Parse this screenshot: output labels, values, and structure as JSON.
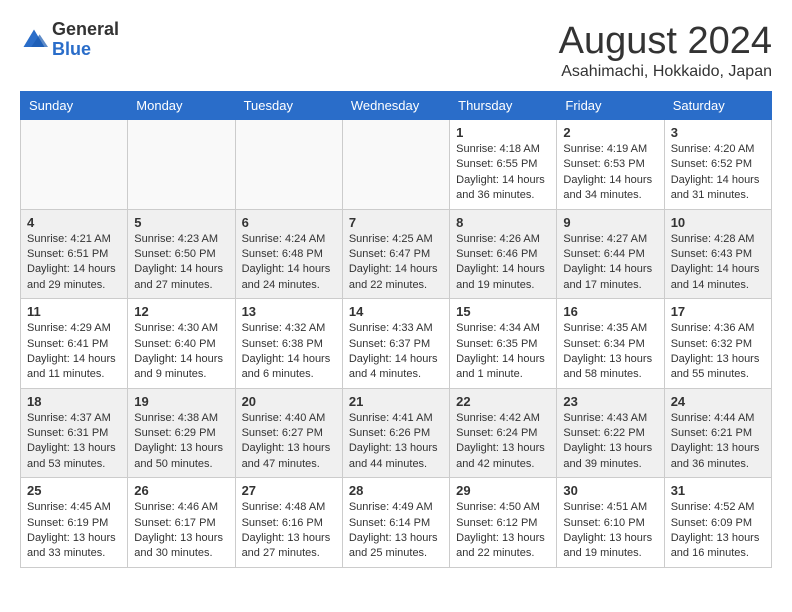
{
  "header": {
    "logo_general": "General",
    "logo_blue": "Blue",
    "month_title": "August 2024",
    "location": "Asahimachi, Hokkaido, Japan"
  },
  "weekdays": [
    "Sunday",
    "Monday",
    "Tuesday",
    "Wednesday",
    "Thursday",
    "Friday",
    "Saturday"
  ],
  "weeks": [
    [
      {
        "day": "",
        "info": "",
        "empty": true
      },
      {
        "day": "",
        "info": "",
        "empty": true
      },
      {
        "day": "",
        "info": "",
        "empty": true
      },
      {
        "day": "",
        "info": "",
        "empty": true
      },
      {
        "day": "1",
        "info": "Sunrise: 4:18 AM\nSunset: 6:55 PM\nDaylight: 14 hours\nand 36 minutes.",
        "empty": false
      },
      {
        "day": "2",
        "info": "Sunrise: 4:19 AM\nSunset: 6:53 PM\nDaylight: 14 hours\nand 34 minutes.",
        "empty": false
      },
      {
        "day": "3",
        "info": "Sunrise: 4:20 AM\nSunset: 6:52 PM\nDaylight: 14 hours\nand 31 minutes.",
        "empty": false
      }
    ],
    [
      {
        "day": "4",
        "info": "Sunrise: 4:21 AM\nSunset: 6:51 PM\nDaylight: 14 hours\nand 29 minutes.",
        "empty": false
      },
      {
        "day": "5",
        "info": "Sunrise: 4:23 AM\nSunset: 6:50 PM\nDaylight: 14 hours\nand 27 minutes.",
        "empty": false
      },
      {
        "day": "6",
        "info": "Sunrise: 4:24 AM\nSunset: 6:48 PM\nDaylight: 14 hours\nand 24 minutes.",
        "empty": false
      },
      {
        "day": "7",
        "info": "Sunrise: 4:25 AM\nSunset: 6:47 PM\nDaylight: 14 hours\nand 22 minutes.",
        "empty": false
      },
      {
        "day": "8",
        "info": "Sunrise: 4:26 AM\nSunset: 6:46 PM\nDaylight: 14 hours\nand 19 minutes.",
        "empty": false
      },
      {
        "day": "9",
        "info": "Sunrise: 4:27 AM\nSunset: 6:44 PM\nDaylight: 14 hours\nand 17 minutes.",
        "empty": false
      },
      {
        "day": "10",
        "info": "Sunrise: 4:28 AM\nSunset: 6:43 PM\nDaylight: 14 hours\nand 14 minutes.",
        "empty": false
      }
    ],
    [
      {
        "day": "11",
        "info": "Sunrise: 4:29 AM\nSunset: 6:41 PM\nDaylight: 14 hours\nand 11 minutes.",
        "empty": false
      },
      {
        "day": "12",
        "info": "Sunrise: 4:30 AM\nSunset: 6:40 PM\nDaylight: 14 hours\nand 9 minutes.",
        "empty": false
      },
      {
        "day": "13",
        "info": "Sunrise: 4:32 AM\nSunset: 6:38 PM\nDaylight: 14 hours\nand 6 minutes.",
        "empty": false
      },
      {
        "day": "14",
        "info": "Sunrise: 4:33 AM\nSunset: 6:37 PM\nDaylight: 14 hours\nand 4 minutes.",
        "empty": false
      },
      {
        "day": "15",
        "info": "Sunrise: 4:34 AM\nSunset: 6:35 PM\nDaylight: 14 hours\nand 1 minute.",
        "empty": false
      },
      {
        "day": "16",
        "info": "Sunrise: 4:35 AM\nSunset: 6:34 PM\nDaylight: 13 hours\nand 58 minutes.",
        "empty": false
      },
      {
        "day": "17",
        "info": "Sunrise: 4:36 AM\nSunset: 6:32 PM\nDaylight: 13 hours\nand 55 minutes.",
        "empty": false
      }
    ],
    [
      {
        "day": "18",
        "info": "Sunrise: 4:37 AM\nSunset: 6:31 PM\nDaylight: 13 hours\nand 53 minutes.",
        "empty": false
      },
      {
        "day": "19",
        "info": "Sunrise: 4:38 AM\nSunset: 6:29 PM\nDaylight: 13 hours\nand 50 minutes.",
        "empty": false
      },
      {
        "day": "20",
        "info": "Sunrise: 4:40 AM\nSunset: 6:27 PM\nDaylight: 13 hours\nand 47 minutes.",
        "empty": false
      },
      {
        "day": "21",
        "info": "Sunrise: 4:41 AM\nSunset: 6:26 PM\nDaylight: 13 hours\nand 44 minutes.",
        "empty": false
      },
      {
        "day": "22",
        "info": "Sunrise: 4:42 AM\nSunset: 6:24 PM\nDaylight: 13 hours\nand 42 minutes.",
        "empty": false
      },
      {
        "day": "23",
        "info": "Sunrise: 4:43 AM\nSunset: 6:22 PM\nDaylight: 13 hours\nand 39 minutes.",
        "empty": false
      },
      {
        "day": "24",
        "info": "Sunrise: 4:44 AM\nSunset: 6:21 PM\nDaylight: 13 hours\nand 36 minutes.",
        "empty": false
      }
    ],
    [
      {
        "day": "25",
        "info": "Sunrise: 4:45 AM\nSunset: 6:19 PM\nDaylight: 13 hours\nand 33 minutes.",
        "empty": false
      },
      {
        "day": "26",
        "info": "Sunrise: 4:46 AM\nSunset: 6:17 PM\nDaylight: 13 hours\nand 30 minutes.",
        "empty": false
      },
      {
        "day": "27",
        "info": "Sunrise: 4:48 AM\nSunset: 6:16 PM\nDaylight: 13 hours\nand 27 minutes.",
        "empty": false
      },
      {
        "day": "28",
        "info": "Sunrise: 4:49 AM\nSunset: 6:14 PM\nDaylight: 13 hours\nand 25 minutes.",
        "empty": false
      },
      {
        "day": "29",
        "info": "Sunrise: 4:50 AM\nSunset: 6:12 PM\nDaylight: 13 hours\nand 22 minutes.",
        "empty": false
      },
      {
        "day": "30",
        "info": "Sunrise: 4:51 AM\nSunset: 6:10 PM\nDaylight: 13 hours\nand 19 minutes.",
        "empty": false
      },
      {
        "day": "31",
        "info": "Sunrise: 4:52 AM\nSunset: 6:09 PM\nDaylight: 13 hours\nand 16 minutes.",
        "empty": false
      }
    ]
  ]
}
